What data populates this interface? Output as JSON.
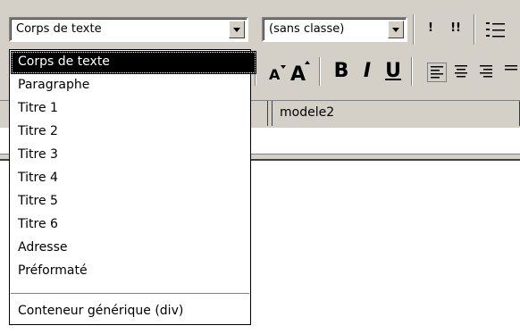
{
  "toolbar": {
    "paragraph_style_value": "Corps de texte",
    "class_value": "(sans classe)",
    "bold_label": "B",
    "italic_label": "I",
    "underline_label": "U",
    "font_smaller_label": "A",
    "font_larger_label": "A",
    "btn1_label": "!",
    "btn2_label": "!!"
  },
  "dropdown": {
    "items": [
      "Corps de texte",
      "Paragraphe",
      "Titre 1",
      "Titre 2",
      "Titre 3",
      "Titre 4",
      "Titre 5",
      "Titre 6",
      "Adresse",
      "Préformaté"
    ],
    "extra_item": "Conteneur générique (div)",
    "selected_index": 0
  },
  "tabs": {
    "active_label": "modele2"
  },
  "colors": {
    "chrome": "#d4d0c8",
    "selection": "#000000",
    "editor": "#ffffff"
  }
}
